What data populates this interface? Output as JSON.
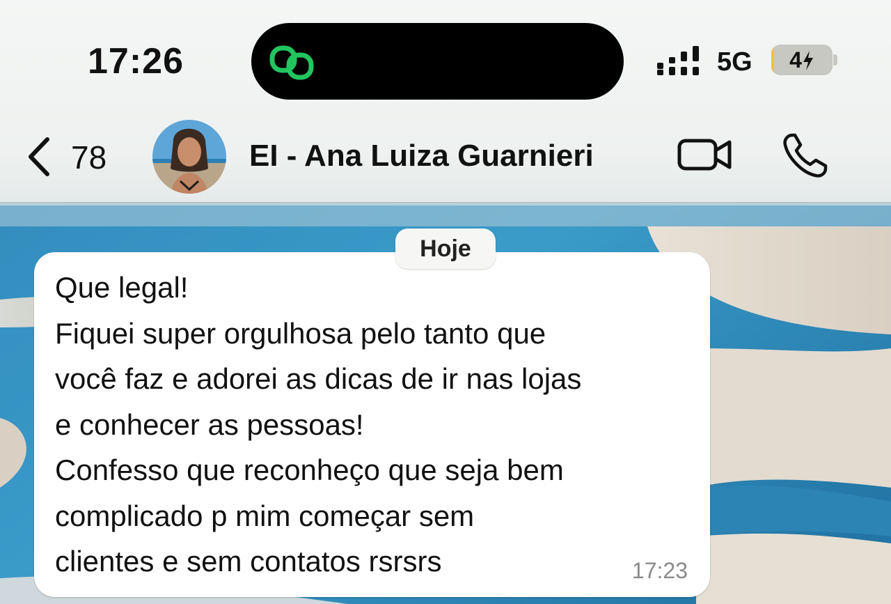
{
  "status_bar": {
    "time": "17:26",
    "network": "5G",
    "battery": "4",
    "battery_level": 0.04,
    "signal_icon": "signal-bars-icon",
    "activity_icon": "link-rings-icon"
  },
  "header": {
    "back_count": "78",
    "contact_name": "EI - Ana Luiza Guarnieri",
    "icons": {
      "back": "chevron-left-icon",
      "video": "video-camera-icon",
      "call": "phone-icon"
    }
  },
  "chat": {
    "date_label": "Hoje",
    "messages": [
      {
        "lines": [
          "Que legal!",
          "Fiquei super orgulhosa pelo tanto que",
          "você faz e adorei as dicas de ir nas lojas",
          "e conhecer as pessoas!",
          "Confesso que reconheço que seja bem",
          "complicado p mim começar sem",
          "clientes e sem contatos rsrsrs"
        ],
        "time": "17:23"
      }
    ]
  },
  "colors": {
    "island_icon": "#22c55e",
    "battery_fill": "#f2c230",
    "bubble": "#ffffff",
    "timestamp": "#8a8a8a"
  }
}
